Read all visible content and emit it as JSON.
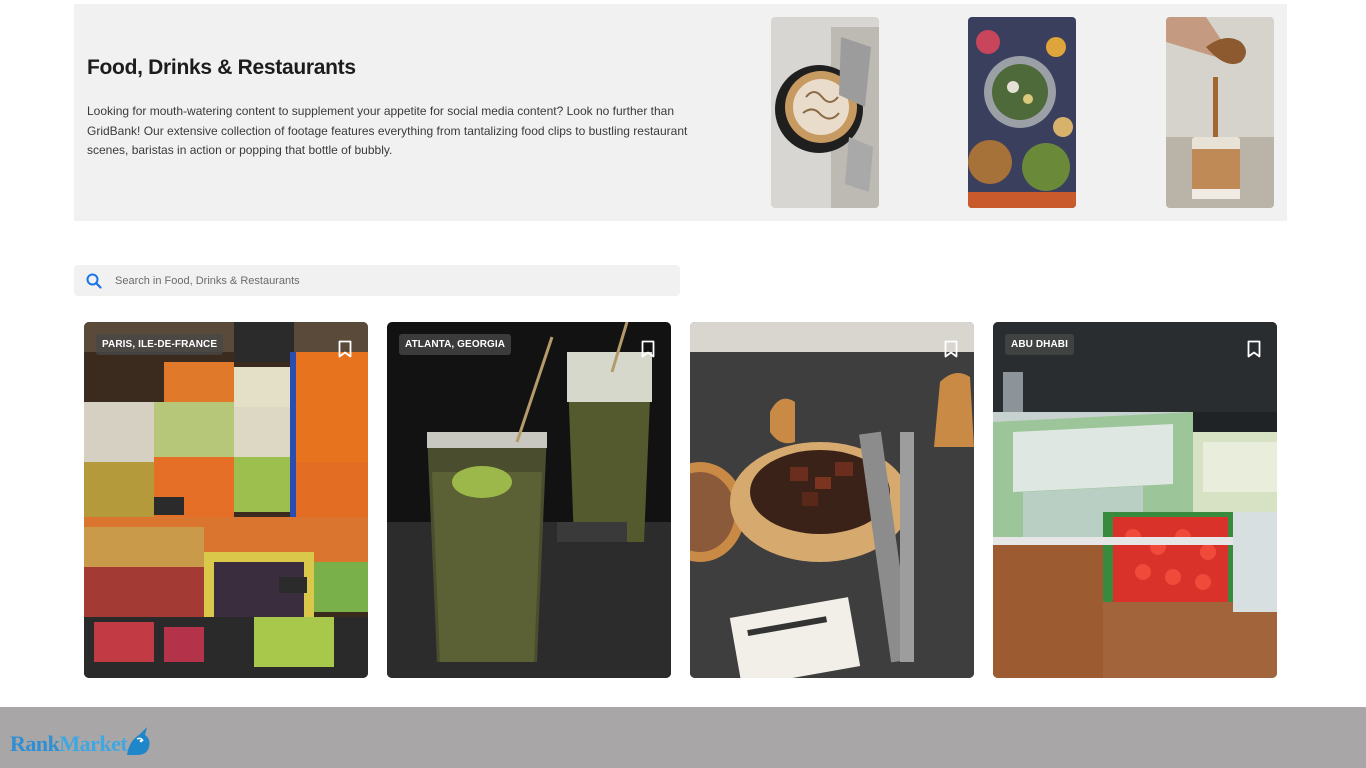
{
  "hero": {
    "title": "Food, Drinks & Restaurants",
    "description": "Looking for mouth-watering content to supplement your appetite for social media content? Look no further than GridBank! Our extensive collection of footage features everything from tantalizing food clips to bustling restaurant scenes, baristas in action or popping that bottle of bubbly."
  },
  "search": {
    "placeholder": "Search in Food, Drinks & Restaurants",
    "value": ""
  },
  "cards": [
    {
      "location": "PARIS, ILE-DE-FRANCE"
    },
    {
      "location": "ATLANTA, GEORGIA"
    },
    {
      "location": ""
    },
    {
      "location": "ABU DHABI"
    }
  ],
  "footer": {
    "logo_part1": "Rank",
    "logo_part2": "Market"
  },
  "colors": {
    "accent": "#1a73e8",
    "hero_bg": "#f1f1f1",
    "footer_bg": "#a8a6a7"
  },
  "icons": [
    "search-icon",
    "bookmark-icon",
    "unicorn-logo-icon"
  ]
}
